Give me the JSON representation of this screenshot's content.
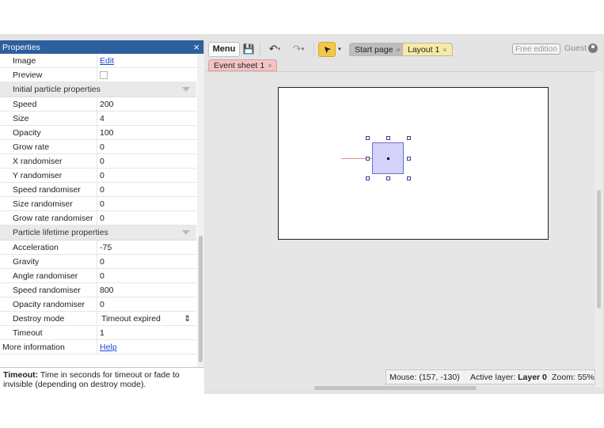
{
  "properties_panel": {
    "title": "Properties",
    "close_icon": "×",
    "rows_top": [
      {
        "label": "Image",
        "value": "Edit",
        "kind": "link"
      },
      {
        "label": "Preview",
        "value": "",
        "kind": "checkbox"
      }
    ],
    "section_initial": "Initial particle properties",
    "initial_rows": [
      {
        "label": "Speed",
        "value": "200"
      },
      {
        "label": "Size",
        "value": "4"
      },
      {
        "label": "Opacity",
        "value": "100"
      },
      {
        "label": "Grow rate",
        "value": "0"
      },
      {
        "label": "X randomiser",
        "value": "0"
      },
      {
        "label": "Y randomiser",
        "value": "0"
      },
      {
        "label": "Speed randomiser",
        "value": "0"
      },
      {
        "label": "Size randomiser",
        "value": "0"
      },
      {
        "label": "Grow rate randomiser",
        "value": "0"
      }
    ],
    "section_lifetime": "Particle lifetime properties",
    "lifetime_rows": [
      {
        "label": "Acceleration",
        "value": "-75"
      },
      {
        "label": "Gravity",
        "value": "0"
      },
      {
        "label": "Angle randomiser",
        "value": "0"
      },
      {
        "label": "Speed randomiser",
        "value": "800"
      },
      {
        "label": "Opacity randomiser",
        "value": "0"
      },
      {
        "label": "Destroy mode",
        "value": "Timeout expired"
      },
      {
        "label": "Timeout",
        "value": "1"
      }
    ],
    "more_info_label": "More information",
    "more_info_link": "Help",
    "help_title": "Timeout:",
    "help_text": " Time in seconds for timeout or fade to invisible (depending on destroy mode)."
  },
  "toolbar": {
    "menu_label": "Menu",
    "save_glyph": "💾",
    "undo_glyph": "↶",
    "redo_glyph": "↷",
    "select_glyph": "➤"
  },
  "tabs": [
    {
      "label": "Start page",
      "close": "×"
    },
    {
      "label": "Layout 1",
      "close": "×"
    }
  ],
  "subtab": {
    "label": "Event sheet 1",
    "close": "×"
  },
  "free_edition": "Free edition",
  "user": "Guest",
  "status": {
    "mouse": "Mouse: (157, -130)",
    "active_layer_label": "Active layer: ",
    "active_layer_value": "Layer 0",
    "zoom": "Zoom: 55%"
  }
}
